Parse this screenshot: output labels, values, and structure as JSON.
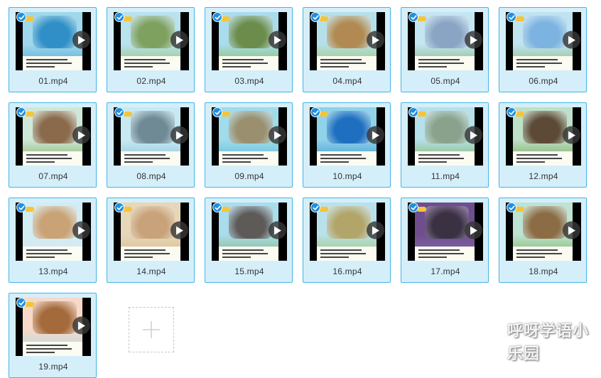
{
  "files": [
    {
      "name": "01.mp4",
      "selected": true,
      "sky": "#9fd8ec",
      "photo": "#2f8fc6",
      "ground": "#4aa3d1"
    },
    {
      "name": "02.mp4",
      "selected": true,
      "sky": "#b7e2ee",
      "photo": "#7fa160",
      "ground": "#8fbf5e"
    },
    {
      "name": "03.mp4",
      "selected": true,
      "sky": "#a9dcec",
      "photo": "#6b8c4a",
      "ground": "#7fb84c"
    },
    {
      "name": "04.mp4",
      "selected": true,
      "sky": "#b5e0ea",
      "photo": "#b08a52",
      "ground": "#9cc257"
    },
    {
      "name": "05.mp4",
      "selected": true,
      "sky": "#c4e6f2",
      "photo": "#8aa5c4",
      "ground": "#79b16a"
    },
    {
      "name": "06.mp4",
      "selected": true,
      "sky": "#bfe3f1",
      "photo": "#7db3e0",
      "ground": "#89b86c"
    },
    {
      "name": "07.mp4",
      "selected": true,
      "sky": "#cfe7d8",
      "photo": "#8a6a4a",
      "ground": "#7fae58"
    },
    {
      "name": "08.mp4",
      "selected": true,
      "sky": "#c7e9f3",
      "photo": "#6f8a95",
      "ground": "#87c0d8"
    },
    {
      "name": "09.mp4",
      "selected": true,
      "sky": "#9fdcec",
      "photo": "#9a8f6e",
      "ground": "#58b5d9"
    },
    {
      "name": "10.mp4",
      "selected": true,
      "sky": "#8fd2ea",
      "photo": "#1f6fc0",
      "ground": "#3a93cf"
    },
    {
      "name": "11.mp4",
      "selected": true,
      "sky": "#b6e0ea",
      "photo": "#8aa28c",
      "ground": "#7fb155"
    },
    {
      "name": "12.mp4",
      "selected": true,
      "sky": "#bfe0c8",
      "photo": "#5c4a36",
      "ground": "#6fa24c"
    },
    {
      "name": "13.mp4",
      "selected": true,
      "sky": "#d2ecf3",
      "photo": "#c9a275",
      "ground": "#d9e8ee"
    },
    {
      "name": "14.mp4",
      "selected": true,
      "sky": "#e6d7b8",
      "photo": "#c8a27a",
      "ground": "#d6b88a"
    },
    {
      "name": "15.mp4",
      "selected": true,
      "sky": "#a9dcec",
      "photo": "#5d5a58",
      "ground": "#86b26a"
    },
    {
      "name": "16.mp4",
      "selected": true,
      "sky": "#b9e1ec",
      "photo": "#b2a56a",
      "ground": "#9ac45a"
    },
    {
      "name": "17.mp4",
      "selected": true,
      "sky": "#6e4e8f",
      "photo": "#3a3142",
      "ground": "#8a6fb0"
    },
    {
      "name": "18.mp4",
      "selected": true,
      "sky": "#bde3d2",
      "photo": "#8c6c45",
      "ground": "#7cae52"
    },
    {
      "name": "19.mp4",
      "selected": true,
      "sky": "#f6d9c8",
      "photo": "#a46a3c",
      "ground": "#a8dce6"
    }
  ],
  "add_icon": "plus-icon",
  "watermark": "呼呀学语小乐园",
  "colors": {
    "tile_bg": "#d5effa",
    "tile_border": "#43b5e6",
    "check": "#1f8fe0"
  }
}
